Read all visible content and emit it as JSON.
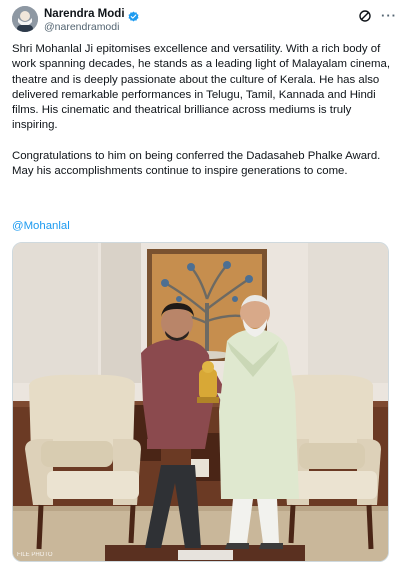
{
  "author": {
    "display_name": "Narendra Modi",
    "handle": "@narendramodi",
    "verified": true,
    "avatar_icon": "profile-avatar"
  },
  "header_icons": {
    "grok": "grok-icon",
    "more": "···"
  },
  "tweet": {
    "paragraph_1": "Shri Mohanlal Ji epitomises excellence and versatility. With a rich body of work spanning decades, he stands as a leading light of Malayalam cinema, theatre and is deeply passionate about the culture of Kerala. He has also delivered remarkable performances in Telugu, Tamil, Kannada and Hindi films. His cinematic and theatrical brilliance across mediums is truly inspiring.",
    "paragraph_2": "Congratulations to him on being conferred the Dadasaheb Phalke Award. May his accomplishments continue to inspire generations to come.",
    "mention": "@Mohanlal"
  },
  "media": {
    "watermark": "FILE PHOTO"
  },
  "colors": {
    "link": "#1d9bf0",
    "verified": "#1d9bf0",
    "text": "#0f1419",
    "secondary": "#536471"
  }
}
